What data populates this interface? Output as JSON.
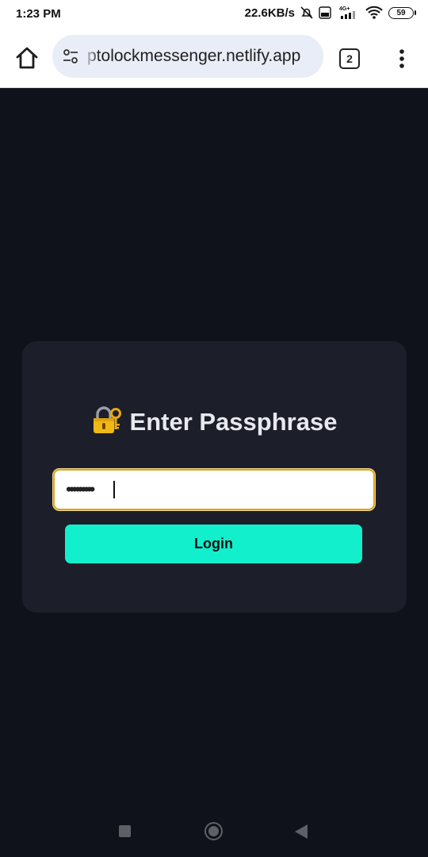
{
  "status": {
    "time": "1:23 PM",
    "net_speed": "22.6KB/s",
    "network": "4G+",
    "battery": "59"
  },
  "browser": {
    "url": "ptolockmessenger.netlify.app",
    "tab_count": "2"
  },
  "login": {
    "title": "Enter Passphrase",
    "title_icon": "locked-with-key-icon",
    "password_mask": "•••••••••",
    "button_label": "Login"
  },
  "colors": {
    "background": "#10121b",
    "card": "#1c1e29",
    "accent": "#12efcd",
    "input_focus_border": "#d9a521"
  }
}
